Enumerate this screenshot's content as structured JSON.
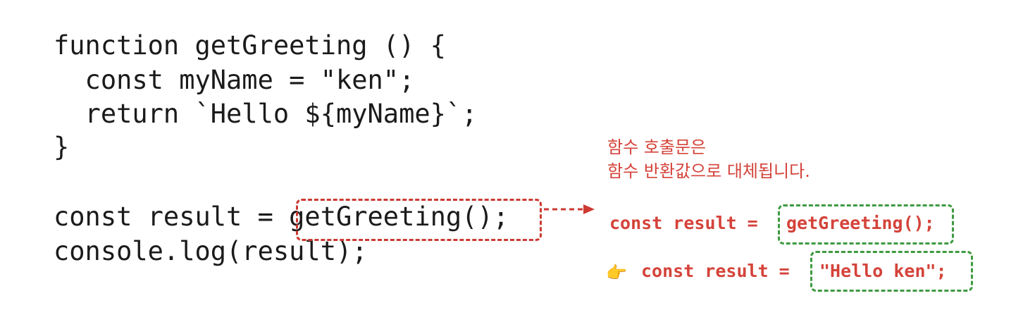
{
  "code": {
    "lines": [
      "function getGreeting () {",
      "  const myName = \"ken\";",
      "  return `Hello ${myName}`;",
      "}",
      "",
      "const result = getGreeting();",
      "console.log(result);"
    ]
  },
  "annotation": {
    "caption_line1": "함수 호출문은",
    "caption_line2": "함수 반환값으로 대체됩니다.",
    "call_prefix": "const result = ",
    "call_expr": "getGreeting();",
    "result_prefix": "const result = ",
    "result_expr": "\"Hello ken\";",
    "pointer_icon": "pointing-hand-icon"
  },
  "colors": {
    "code_text": "#1b1b1b",
    "highlight_red": "#cc3a32",
    "highlight_green": "#3e9a41",
    "annotation_text": "#d4433a"
  }
}
